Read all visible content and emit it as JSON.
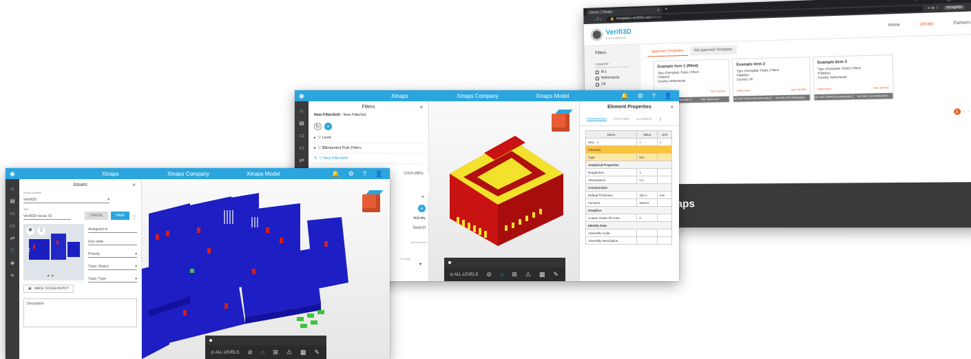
{
  "browser": {
    "tab_title": "Library | Xinaps",
    "tab_close": "×",
    "new_tab": "+",
    "window_controls": "•  –  ▢  ×",
    "nav_buttons": "←  →  C  ⌂",
    "url_host": "templates.verifi3d.com",
    "url_path": "/library",
    "toolbar_icons": "≡  ⊕  ☆",
    "incognito_label": "Incognito",
    "menu_dots": "⋮"
  },
  "site": {
    "logo_title": "Verifi3D",
    "logo_sub": "EXCHANGE",
    "nav": [
      "Home",
      "Library",
      "Partners"
    ],
    "nav_active": "Library",
    "filters_title": "Filters",
    "country_label": "COUNTRY",
    "countries": [
      "ALL",
      "Netherlands",
      "UK"
    ],
    "tabs": [
      "Approved Templates",
      "Not approved Templates"
    ],
    "cards": [
      {
        "title": "Example item 1 (filled)",
        "line1": "Type of template: Rules | Filters",
        "line2": "Publisher",
        "line3": "Country: Netherlands",
        "preview": "PREVIEW",
        "more": "SEE MORE",
        "btn1": "NO V3D TEMPLATE AVAILABLE",
        "btn2": "XML TEMPLATE"
      },
      {
        "title": "Example item 2",
        "line1": "Type of template: Rules | Filters",
        "line2": "Publisher",
        "line3": "Country: UK",
        "preview": "PREVIEW",
        "more": "SEE MORE",
        "btn1": "NO V3D TEMPLATE AVAILABLE",
        "btn2": "NO XML FILE AVAILABLE"
      },
      {
        "title": "Example item 3",
        "line1": "Type of template: Rules | Filters",
        "line2": "Publisher",
        "line3": "Country: Netherlands",
        "preview": "PREVIEW",
        "more": "SEE MORE",
        "btn1": "NO V3D TEMPLATE AVAILABLE",
        "btn2": "NO XML FILE AVAILABLE"
      }
    ],
    "pager_current": "1",
    "pager_prev": "‹",
    "pager_next": "›",
    "footer_text": "aps"
  },
  "app_header": {
    "brand": "Xinaps",
    "company": "Xinaps Company",
    "model": "Xinaps Model",
    "notif_count": "1"
  },
  "filters_window": {
    "panel_title": "Filters",
    "close": "×",
    "filterset_name": "New FilterSet0",
    "filterset_desc": ": New FilterSet",
    "tree": [
      "Level",
      "$$Imported Rule Filters",
      "New FilterSet0"
    ],
    "count_text": "12204 (88%)",
    "second_close": "×",
    "entity_label": "IfcEntity",
    "search_btn": "Search",
    "ifc_label": "IfcDiscSpace",
    "per_page": "Per page",
    "props_title": "Element Properties",
    "props_close": "×",
    "props_tabs": [
      "PROPERTIES",
      "LOCATION",
      "CLASSIFIC"
    ],
    "col_name": "Name",
    "col_value": "Value",
    "col_unit": "Unit",
    "search_placeholder": "Sea...",
    "rows": [
      {
        "name": "Favorites",
        "kind": "fav",
        "value": "",
        "unit": ""
      },
      {
        "name": "Type",
        "kind": "type",
        "value": "N/A",
        "unit": ""
      },
      {
        "name": "Analytical Properties",
        "kind": "grp",
        "value": "",
        "unit": ""
      },
      {
        "name": "Roughness",
        "kind": "row",
        "value": "1",
        "unit": ""
      },
      {
        "name": "Absorptance",
        "kind": "row",
        "value": "0.1",
        "unit": ""
      },
      {
        "name": "Construction",
        "kind": "grp",
        "value": "",
        "unit": ""
      },
      {
        "name": "Default Thickness",
        "kind": "row",
        "value": "152.4",
        "unit": "mm"
      },
      {
        "name": "Function",
        "kind": "row",
        "value": "Interior",
        "unit": ""
      },
      {
        "name": "Graphics",
        "kind": "grp",
        "value": "",
        "unit": ""
      },
      {
        "name": "Coarse Scale Fill Color",
        "kind": "row",
        "value": "0",
        "unit": ""
      },
      {
        "name": "Identity Data",
        "kind": "grp",
        "value": "",
        "unit": ""
      },
      {
        "name": "Assembly Code",
        "kind": "row",
        "value": "",
        "unit": ""
      },
      {
        "name": "Assembly Description",
        "kind": "row",
        "value": "",
        "unit": ""
      }
    ]
  },
  "issues_window": {
    "panel_title": "Issues",
    "close": "×",
    "select_provider_label": "Select provider",
    "provider_value": "Verifi3D",
    "title_label": "Title",
    "title_value": "Verifi3D Issue #2",
    "cancel": "CANCEL",
    "save": "SAVE",
    "fields": [
      "Assigned to",
      "Due date",
      "Priority",
      "Topic Status",
      "Topic Type"
    ],
    "screenshot_btn": "MAKE SCREENSHOT",
    "description_label": "Description"
  },
  "viewer": {
    "all_levels": "ALL LEVELS",
    "tools": [
      "⊘",
      "⌂",
      "⊞",
      "⚠",
      "▦",
      "⌗",
      "✎"
    ]
  }
}
